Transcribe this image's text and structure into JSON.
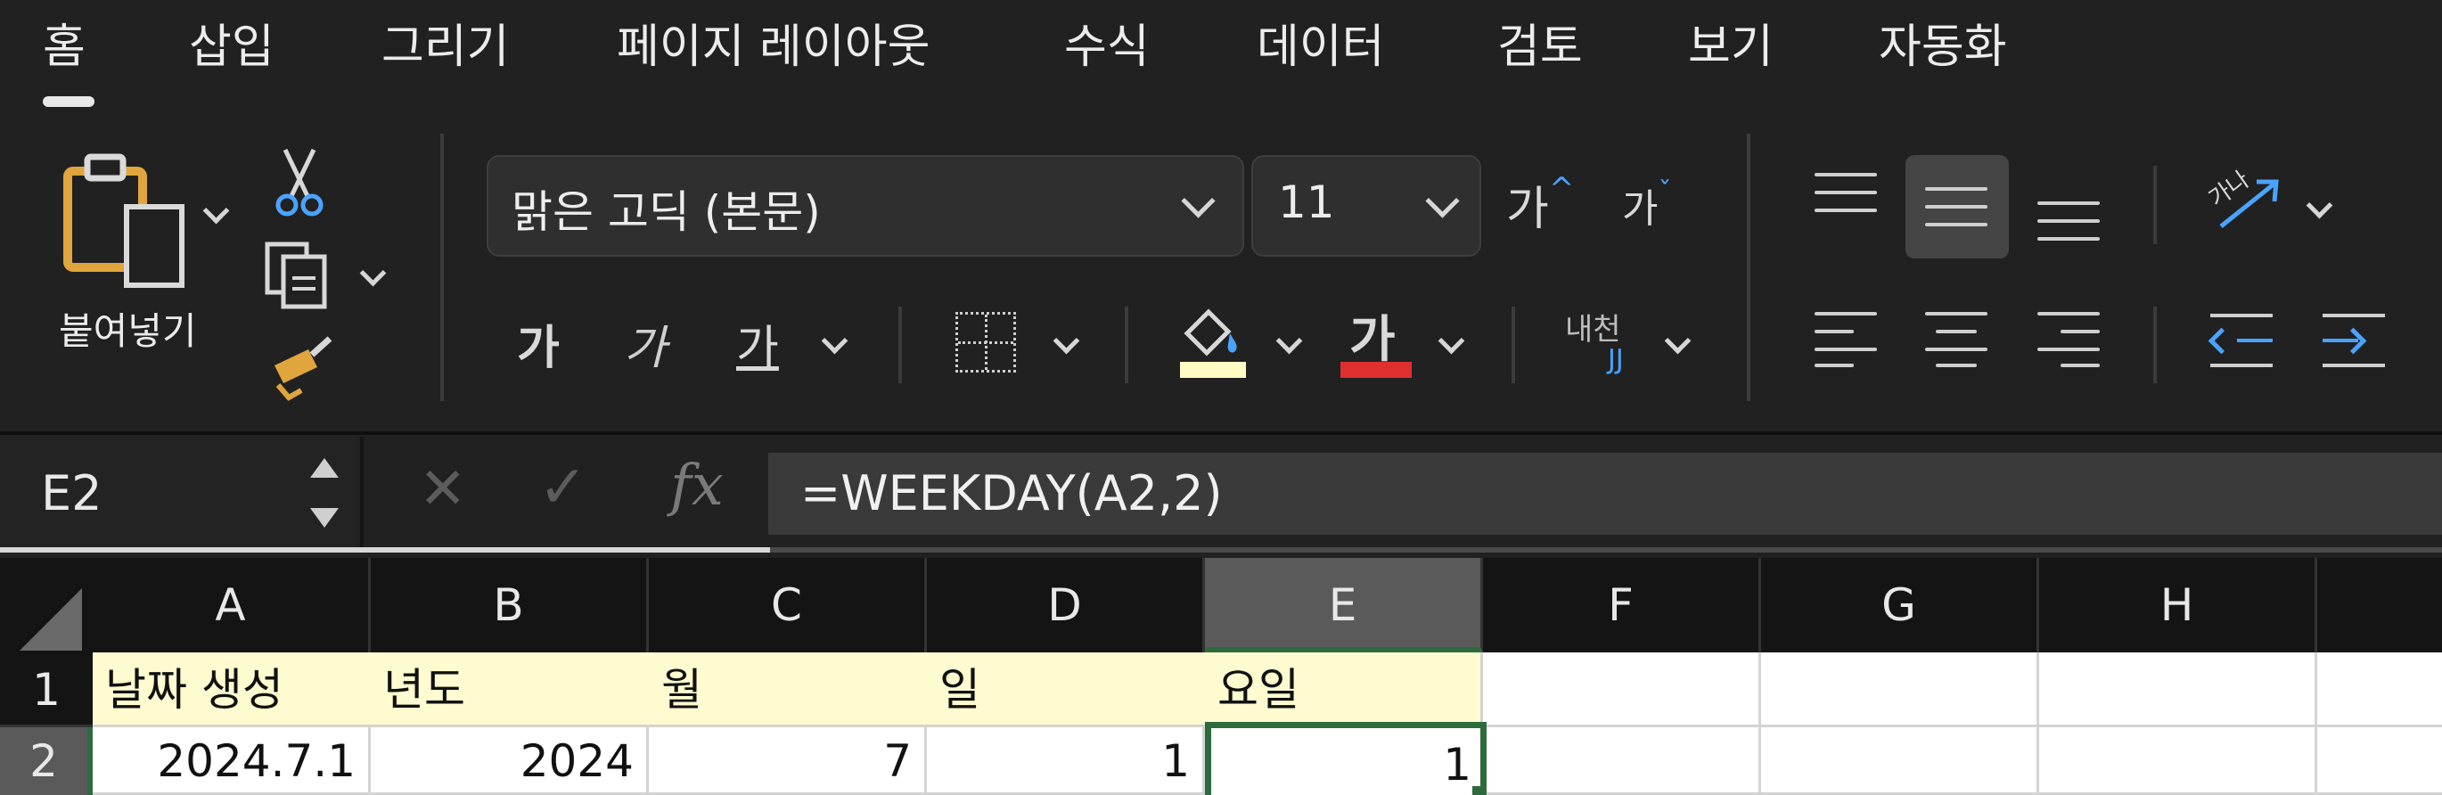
{
  "tabs": [
    "홈",
    "삽입",
    "그리기",
    "페이지 레이아웃",
    "수식",
    "데이터",
    "검토",
    "보기",
    "자동화"
  ],
  "clipboard": {
    "paste_label": "붙여넣기"
  },
  "font": {
    "name": "맑은 고딕 (본문)",
    "size": "11",
    "grow_glyph": "가",
    "shrink_glyph": "가"
  },
  "format": {
    "bold": "가",
    "italic": "가",
    "underline": "가",
    "font_color_glyph": "가",
    "fill_color": "#fffbc4",
    "font_color": "#e02f2f",
    "phonetic_top": "내천",
    "phonetic_bottom": "JJ",
    "orientation_glyph": "가나"
  },
  "formula_bar": {
    "cell_ref": "E2",
    "fx": "fx",
    "formula": "=WEEKDAY(A2,2)"
  },
  "grid": {
    "columns": [
      "A",
      "B",
      "C",
      "D",
      "E",
      "F",
      "G",
      "H"
    ],
    "selected_column": "E",
    "rows": [
      {
        "num": "1",
        "cells": [
          "날짜 생성",
          "년도",
          "월",
          "일",
          "요일",
          "",
          "",
          ""
        ]
      },
      {
        "num": "2",
        "cells": [
          "2024.7.1",
          "2024",
          "7",
          "1",
          "1",
          "",
          "",
          ""
        ]
      }
    ]
  },
  "colors": {
    "ribbon_bg": "#212121",
    "header_bg": "#141414",
    "selection_border": "#2e6b3c",
    "accent_blue": "#4aa3ff"
  }
}
